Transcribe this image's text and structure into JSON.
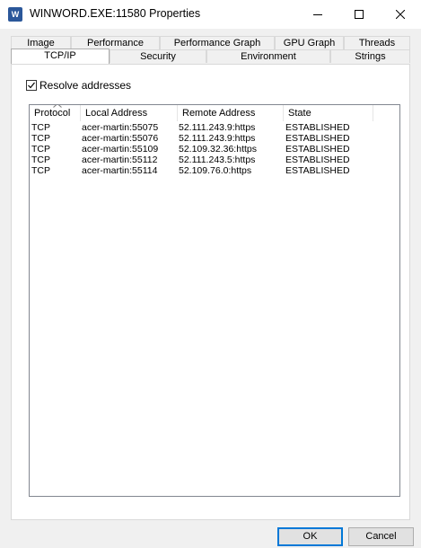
{
  "window": {
    "app_icon_letter": "W",
    "title": "WINWORD.EXE:11580 Properties",
    "controls": {
      "minimize_icon": "minimize-icon",
      "maximize_icon": "maximize-icon",
      "close_icon": "close-icon"
    }
  },
  "tabs": {
    "row_back": [
      "Image",
      "Performance",
      "Performance Graph",
      "GPU Graph",
      "Threads"
    ],
    "row_front": [
      "TCP/IP",
      "Security",
      "Environment",
      "Strings"
    ],
    "active": "TCP/IP"
  },
  "tcpip": {
    "resolve_label": "Resolve addresses",
    "resolve_checked": true,
    "columns": [
      "Protocol",
      "Local Address",
      "Remote Address",
      "State"
    ],
    "rows": [
      [
        "TCP",
        "acer-martin:55075",
        "52.111.243.9:https",
        "ESTABLISHED"
      ],
      [
        "TCP",
        "acer-martin:55076",
        "52.111.243.9:https",
        "ESTABLISHED"
      ],
      [
        "TCP",
        "acer-martin:55109",
        "52.109.32.36:https",
        "ESTABLISHED"
      ],
      [
        "TCP",
        "acer-martin:55112",
        "52.111.243.5:https",
        "ESTABLISHED"
      ],
      [
        "TCP",
        "acer-martin:55114",
        "52.109.76.0:https",
        "ESTABLISHED"
      ]
    ]
  },
  "buttons": {
    "ok": "OK",
    "cancel": "Cancel"
  },
  "colors": {
    "accent": "#0078d7",
    "app_icon": "#2b579a"
  }
}
